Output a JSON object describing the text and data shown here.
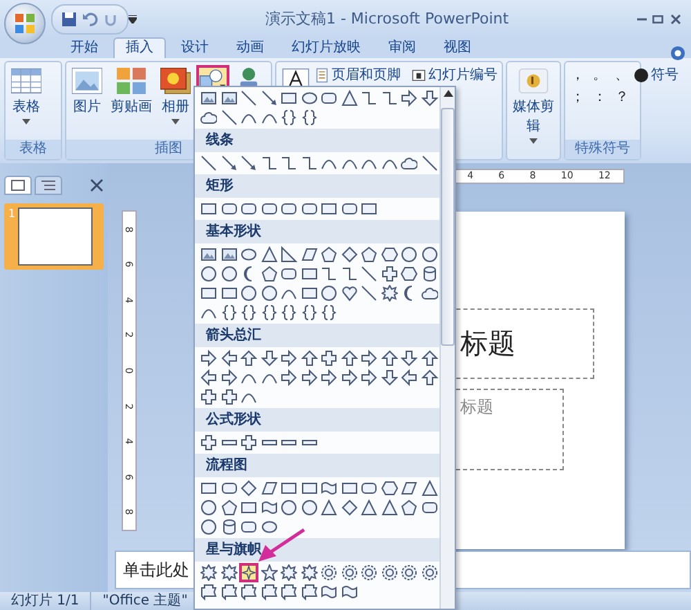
{
  "window": {
    "title": "演示文稿1 - Microsoft PowerPoint"
  },
  "tabs": [
    {
      "label": "开始",
      "selected": false
    },
    {
      "label": "插入",
      "selected": true
    },
    {
      "label": "设计",
      "selected": false
    },
    {
      "label": "动画",
      "selected": false
    },
    {
      "label": "幻灯片放映",
      "selected": false
    },
    {
      "label": "审阅",
      "selected": false
    },
    {
      "label": "视图",
      "selected": false
    }
  ],
  "ribbon": {
    "groups": [
      {
        "label": "表格",
        "items": [
          {
            "kind": "large",
            "label": "表格"
          }
        ]
      },
      {
        "label": "插图",
        "items": [
          {
            "kind": "large",
            "label": "图片"
          },
          {
            "kind": "large",
            "label": "剪贴画"
          },
          {
            "kind": "large",
            "label": "相册"
          },
          {
            "kind": "icon",
            "selected": true
          },
          {
            "kind": "icon",
            "selected": false
          }
        ]
      },
      {
        "items": [
          {
            "kind": "icon",
            "selected": false
          },
          {
            "kind": "small",
            "label": "页眉和页脚"
          },
          {
            "kind": "small",
            "label": "幻灯片编号"
          }
        ]
      },
      {
        "items": [
          {
            "kind": "large",
            "label": "媒体剪辑"
          }
        ]
      },
      {
        "label": "特殊符号",
        "items": [
          {
            "kind": "symbols",
            "symbols": [
              "，",
              "。",
              "、",
              "；",
              "：",
              "？"
            ]
          },
          {
            "kind": "small",
            "label": "符号"
          }
        ]
      }
    ]
  },
  "shape_menu": {
    "sections": [
      {
        "items": [
          {
            "selected": false
          },
          {
            "selected": false
          },
          {
            "selected": false
          },
          {
            "selected": false
          },
          {
            "selected": false
          },
          {
            "selected": false
          },
          {
            "selected": false
          },
          {
            "selected": false
          },
          {
            "selected": false
          },
          {
            "selected": false
          },
          {
            "selected": false
          },
          {
            "selected": false
          },
          {
            "selected": false
          },
          {
            "selected": false
          },
          {
            "selected": false
          },
          {
            "selected": false
          },
          {
            "selected": false
          },
          {
            "selected": false
          }
        ]
      },
      {
        "title": "线条",
        "items": [
          {
            "selected": false
          },
          {
            "selected": false
          },
          {
            "selected": false
          },
          {
            "selected": false
          },
          {
            "selected": false
          },
          {
            "selected": false
          },
          {
            "selected": false
          },
          {
            "selected": false
          },
          {
            "selected": false
          },
          {
            "selected": false
          },
          {
            "selected": false
          },
          {
            "selected": false
          }
        ]
      },
      {
        "title": "矩形",
        "items": [
          {
            "selected": false
          },
          {
            "selected": false
          },
          {
            "selected": false
          },
          {
            "selected": false
          },
          {
            "selected": false
          },
          {
            "selected": false
          },
          {
            "selected": false
          },
          {
            "selected": false
          },
          {
            "selected": false
          }
        ]
      },
      {
        "title": "基本形状",
        "items": [
          {
            "selected": false
          },
          {
            "selected": false
          },
          {
            "selected": false
          },
          {
            "selected": false
          },
          {
            "selected": false
          },
          {
            "selected": false
          },
          {
            "selected": false
          },
          {
            "selected": false
          },
          {
            "selected": false
          },
          {
            "selected": false
          },
          {
            "selected": false
          },
          {
            "selected": false
          },
          {
            "selected": false
          },
          {
            "selected": false
          },
          {
            "selected": false
          },
          {
            "selected": false
          },
          {
            "selected": false
          },
          {
            "selected": false
          },
          {
            "selected": false
          },
          {
            "selected": false
          },
          {
            "selected": false
          },
          {
            "selected": false
          },
          {
            "selected": false
          },
          {
            "selected": false
          },
          {
            "selected": false
          },
          {
            "selected": false
          },
          {
            "selected": false
          },
          {
            "selected": false
          },
          {
            "selected": false
          },
          {
            "selected": false
          },
          {
            "selected": false
          },
          {
            "selected": false
          },
          {
            "selected": false
          },
          {
            "selected": false
          },
          {
            "selected": false
          },
          {
            "selected": false
          },
          {
            "selected": false
          },
          {
            "selected": false
          },
          {
            "selected": false
          },
          {
            "selected": false
          },
          {
            "selected": false
          },
          {
            "selected": false
          },
          {
            "selected": false
          }
        ]
      },
      {
        "title": "箭头总汇",
        "items": [
          {
            "selected": false
          },
          {
            "selected": false
          },
          {
            "selected": false
          },
          {
            "selected": false
          },
          {
            "selected": false
          },
          {
            "selected": false
          },
          {
            "selected": false
          },
          {
            "selected": false
          },
          {
            "selected": false
          },
          {
            "selected": false
          },
          {
            "selected": false
          },
          {
            "selected": false
          },
          {
            "selected": false
          },
          {
            "selected": false
          },
          {
            "selected": false
          },
          {
            "selected": false
          },
          {
            "selected": false
          },
          {
            "selected": false
          },
          {
            "selected": false
          },
          {
            "selected": false
          },
          {
            "selected": false
          },
          {
            "selected": false
          },
          {
            "selected": false
          },
          {
            "selected": false
          },
          {
            "selected": false
          },
          {
            "selected": false
          },
          {
            "selected": false
          }
        ]
      },
      {
        "title": "公式形状",
        "items": [
          {
            "selected": false
          },
          {
            "selected": false
          },
          {
            "selected": false
          },
          {
            "selected": false
          },
          {
            "selected": false
          },
          {
            "selected": false
          }
        ]
      },
      {
        "title": "流程图",
        "items": [
          {
            "selected": false
          },
          {
            "selected": false
          },
          {
            "selected": false
          },
          {
            "selected": false
          },
          {
            "selected": false
          },
          {
            "selected": false
          },
          {
            "selected": false
          },
          {
            "selected": false
          },
          {
            "selected": false
          },
          {
            "selected": false
          },
          {
            "selected": false
          },
          {
            "selected": false
          },
          {
            "selected": false
          },
          {
            "selected": false
          },
          {
            "selected": false
          },
          {
            "selected": false
          },
          {
            "selected": false
          },
          {
            "selected": false
          },
          {
            "selected": false
          },
          {
            "selected": false
          },
          {
            "selected": false
          },
          {
            "selected": false
          },
          {
            "selected": false
          },
          {
            "selected": false
          },
          {
            "selected": false
          },
          {
            "selected": false
          },
          {
            "selected": false
          },
          {
            "selected": false
          }
        ]
      },
      {
        "title": "星与旗帜",
        "items": [
          {
            "selected": false
          },
          {
            "selected": false
          },
          {
            "selected": true
          },
          {
            "selected": false
          },
          {
            "selected": false
          },
          {
            "selected": false
          },
          {
            "selected": false
          },
          {
            "selected": false
          },
          {
            "selected": false
          },
          {
            "selected": false
          },
          {
            "selected": false
          },
          {
            "selected": false
          },
          {
            "selected": false
          },
          {
            "selected": false
          },
          {
            "selected": false
          },
          {
            "selected": false
          },
          {
            "selected": false
          },
          {
            "selected": false
          },
          {
            "selected": false
          },
          {
            "selected": false
          }
        ]
      }
    ]
  },
  "slide_panel": {
    "tabs": [
      {
        "selected": true
      },
      {
        "selected": false
      }
    ],
    "slides": [
      {
        "number": "1",
        "selected": true
      }
    ]
  },
  "horizontal_ruler": [
    "4",
    "6",
    "8",
    "10",
    "12"
  ],
  "vertical_ruler": [
    "8",
    "6",
    "4",
    "2",
    "0",
    "2",
    "4",
    "6",
    "8"
  ],
  "slide": {
    "title_placeholder": "标题",
    "subtitle_placeholder": "标题"
  },
  "notes": {
    "placeholder": "单击此处"
  },
  "status_bar": [
    "幻灯片 1/1",
    "\"Office 主题\""
  ]
}
